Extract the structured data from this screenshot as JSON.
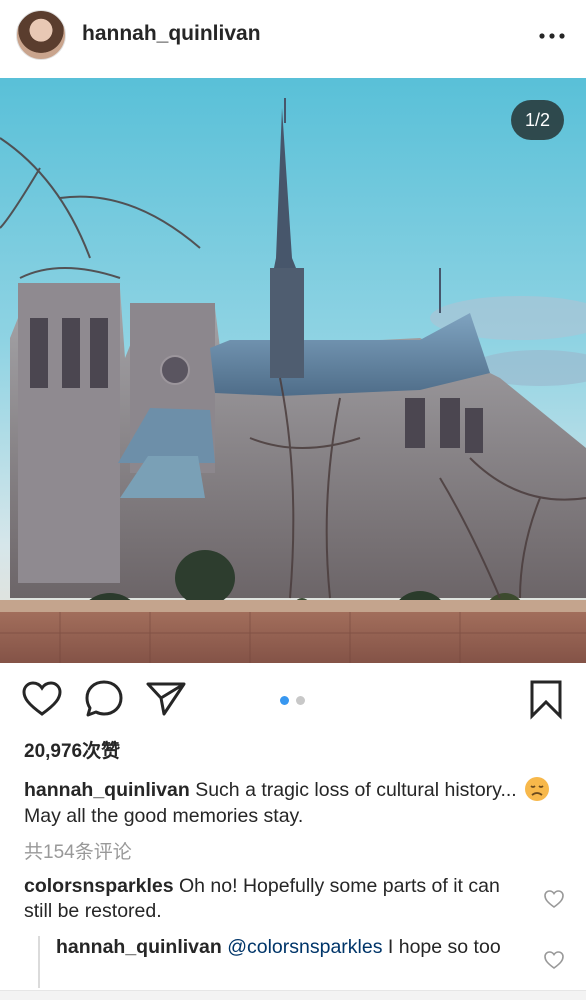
{
  "post": {
    "username": "hannah_quinlivan",
    "image_counter": "1/2",
    "likes": "20,976次赞",
    "caption_user": "hannah_quinlivan",
    "caption_text_before_emoji": "Such a tragic loss of cultural history...",
    "caption_text_after_emoji": "May all the good memories stay.",
    "view_all_comments": "共154条评论"
  },
  "icons": {
    "avatar": "profile-avatar",
    "more": "more-horizontal-icon",
    "like": "heart-icon",
    "comment": "comment-bubble-icon",
    "share": "paper-plane-icon",
    "save": "bookmark-icon",
    "emoji": "disappointed-face-emoji"
  },
  "carousel": {
    "active_index": 1,
    "total": 2,
    "active_color": "#3897f0",
    "inactive_color": "#c8c8c8"
  },
  "comments": [
    {
      "user": "colorsnsparkles",
      "text": "Oh no! Hopefully some parts of it can still be restored."
    }
  ],
  "replies": [
    {
      "user": "hannah_quinlivan",
      "mention": "@colorsnsparkles",
      "text": "I hope so too"
    }
  ],
  "colors": {
    "text": "#262626",
    "muted": "#999999",
    "mention": "#003569"
  }
}
